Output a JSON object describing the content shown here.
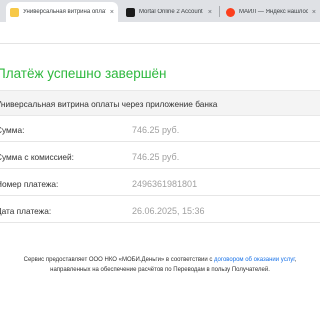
{
  "browser": {
    "tabs": [
      {
        "title": "Универсальная витрина оплаты",
        "icon_color": "#f7c948",
        "active": true
      },
      {
        "title": "Mortal Online 2 Account",
        "icon_color": "#1b1b1b",
        "active": false
      },
      {
        "title": "МАЙЛ — Яндекс нашлось",
        "icon_color": "#fc3f1d",
        "active": false
      }
    ],
    "close_glyph": "×"
  },
  "page": {
    "title": "Платёж успешно завершён",
    "subtitle": "Универсальная витрина оплаты через приложение банка",
    "rows": [
      {
        "label": "Сумма:",
        "value": "746.25 руб."
      },
      {
        "label": "Сумма с комиссией:",
        "value": "746.25 руб."
      },
      {
        "label": "Номер платежа:",
        "value": "2496361981801"
      },
      {
        "label": "Дата платежа:",
        "value": "26.06.2025, 15:36"
      }
    ],
    "footer": {
      "part1": "Сервис предоставляет ООО НКО «МОБИ.Деньги» в соответствии с ",
      "link": "договором об оказании услуг",
      "part2": ",",
      "line2": "направленных на обеспечение расчётов по Переводам в пользу Получателей."
    }
  },
  "colors": {
    "success": "#2db83d",
    "link": "#1a73e8",
    "muted_value": "#a0a0a0"
  }
}
